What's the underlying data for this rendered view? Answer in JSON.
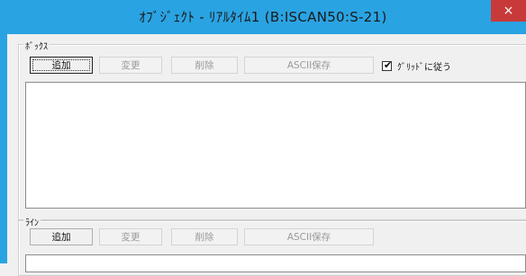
{
  "window": {
    "title": "ｵﾌﾞｼﾞｪｸﾄ - ﾘｱﾙﾀｲﾑ1 (B:ISCAN50:S-21)",
    "close_glyph": "×"
  },
  "box_group": {
    "legend": "ﾎﾞｯｸｽ",
    "add_label": "追加",
    "change_label": "変更",
    "delete_label": "削除",
    "ascii_save_label": "ASCII保存",
    "grid_checkbox_label": "ｸﾞﾘｯﾄﾞに従う",
    "grid_checked": true,
    "check_glyph": "✔"
  },
  "line_group": {
    "legend": "ﾗｲﾝ",
    "add_label": "追加",
    "change_label": "変更",
    "delete_label": "削除",
    "ascii_save_label": "ASCII保存"
  }
}
